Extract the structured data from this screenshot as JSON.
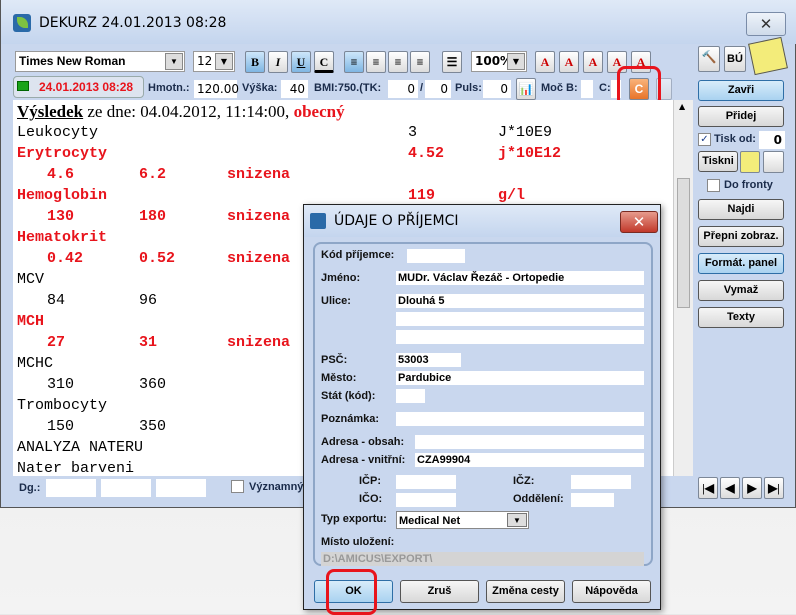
{
  "window": {
    "title": "DEKURZ 24.01.2013 08:28",
    "close": "✕"
  },
  "toolbar": {
    "font": "Times New Roman",
    "size": "12",
    "bold": "B",
    "italic": "I",
    "underline": "U",
    "color": "C",
    "zoom": "100%",
    "bu": "BÚ"
  },
  "info": {
    "datetime": "24.01.2013 08:28",
    "hmotn_label": "Hmotn.:",
    "hmotn": "120.00",
    "vyska_label": "Výška:",
    "vyska": "40",
    "bmi_label": "BMI:750.(TK:",
    "tk1": "0",
    "sep": "/",
    "tk2": "0",
    "puls_label": "Puls:",
    "puls": "0",
    "moc_label": "Moč B:",
    "c_label": "C:"
  },
  "doc": {
    "heading": "Výsledek",
    "heading_rest": " ze dne: 04.04.2012, 11:14:00, ",
    "heading_type": "obecný",
    "rows": [
      {
        "c": [
          "Leukocyty",
          "",
          "",
          "",
          "3",
          "J*10E9"
        ],
        "red": false
      },
      {
        "c": [
          "Erytrocyty",
          "",
          "",
          "",
          "4.52",
          "j*10E12"
        ],
        "red": true
      },
      {
        "c": [
          "",
          "4.6",
          "6.2",
          "snizena",
          "",
          ""
        ],
        "red": true
      },
      {
        "c": [
          "Hemoglobin",
          "",
          "",
          "",
          "119",
          "g/l"
        ],
        "red": true
      },
      {
        "c": [
          "",
          "130",
          "180",
          "snizena",
          "",
          ""
        ],
        "red": true
      },
      {
        "c": [
          "Hematokrit",
          "",
          "",
          "",
          "",
          ""
        ],
        "red": true
      },
      {
        "c": [
          "",
          "0.42",
          "0.52",
          "snizena",
          "",
          ""
        ],
        "red": true
      },
      {
        "c": [
          "MCV",
          "",
          "",
          "",
          "",
          ""
        ],
        "red": false
      },
      {
        "c": [
          "",
          "84",
          "96",
          "",
          "",
          ""
        ],
        "red": false
      },
      {
        "c": [
          "MCH",
          "",
          "",
          "",
          "",
          ""
        ],
        "red": true
      },
      {
        "c": [
          "",
          "27",
          "31",
          "snizena",
          "",
          ""
        ],
        "red": true
      },
      {
        "c": [
          "MCHC",
          "",
          "",
          "",
          "",
          ""
        ],
        "red": false
      },
      {
        "c": [
          "",
          "310",
          "360",
          "",
          "",
          ""
        ],
        "red": false
      },
      {
        "c": [
          "Trombocyty",
          "",
          "",
          "",
          "",
          ""
        ],
        "red": false
      },
      {
        "c": [
          "",
          "150",
          "350",
          "",
          "",
          ""
        ],
        "red": false
      },
      {
        "c": [
          "ANALYZA NATERU",
          "",
          "",
          "",
          "",
          ""
        ],
        "red": false
      },
      {
        "c": [
          "Nater barveni",
          "",
          "",
          "",
          "",
          ""
        ],
        "red": false
      }
    ]
  },
  "bottom": {
    "dg_label": "Dg.:",
    "vyznamny": "Významný"
  },
  "side": {
    "zavri": "Zavři",
    "pridej": "Přidej",
    "tisk_od": "Tisk od:",
    "tisk_od_value": "0",
    "tiskni": "Tiskni",
    "do_fronty": "Do fronty",
    "najdi": "Najdi",
    "prepni": "Přepni zobraz.",
    "format": "Formát. panel",
    "vymaz": "Vymaž",
    "texty": "Texty"
  },
  "dialog": {
    "title": "ÚDAJE O PŘÍJEMCI",
    "close": "✕",
    "kod_label": "Kód příjemce:",
    "kod": "",
    "jmeno_label": "Jméno:",
    "jmeno": "MUDr. Václav Řezáč - Ortopedie",
    "ulice_label": "Ulice:",
    "ulice": "Dlouhá 5",
    "ulice2": "",
    "ulice3": "",
    "psc_label": "PSČ:",
    "psc": "53003",
    "mesto_label": "Město:",
    "mesto": "Pardubice",
    "stat_label": "Stát (kód):",
    "stat": "",
    "poznamka_label": "Poznámka:",
    "poznamka": "",
    "adr_obsah_label": "Adresa - obsah:",
    "adr_obsah": "",
    "adr_vnitrni_label": "Adresa - vnitřní:",
    "adr_vnitrni": "CZA99904",
    "icp_label": "IČP:",
    "icz_label": "IČZ:",
    "ico_label": "IČO:",
    "oddeleni_label": "Oddělení:",
    "typ_label": "Typ exportu:",
    "typ": "Medical Net",
    "misto_label": "Místo uložení:",
    "misto": "D:\\AMICUS\\EXPORT\\",
    "ok": "OK",
    "zrus": "Zruš",
    "zmena": "Změna cesty",
    "napoveda": "Nápověda"
  },
  "colors": {
    "highlight": "#e8141c",
    "red_text": "#e8141c",
    "panel": "#c9d7ee"
  }
}
